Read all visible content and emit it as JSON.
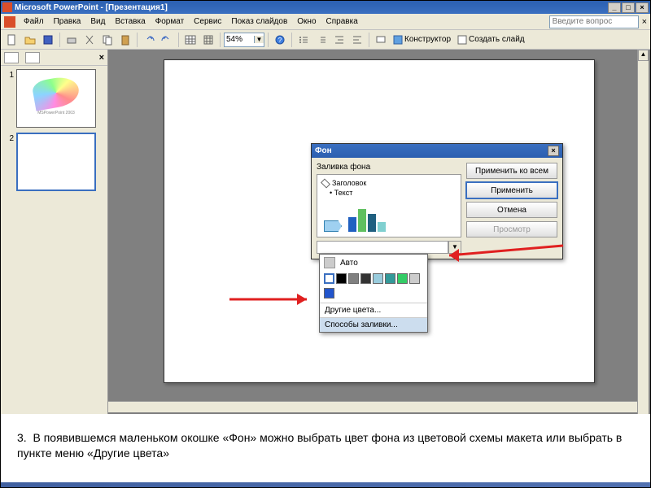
{
  "titlebar": {
    "app": "Microsoft PowerPoint - [Презентация1]"
  },
  "menu": {
    "file": "Файл",
    "edit": "Правка",
    "view": "Вид",
    "insert": "Вставка",
    "format": "Формат",
    "service": "Сервис",
    "slideshow": "Показ слайдов",
    "window": "Окно",
    "help": "Справка",
    "help_placeholder": "Введите вопрос"
  },
  "toolbar": {
    "zoom": "54%",
    "designer": "Конструктор",
    "new_slide": "Создать слайд"
  },
  "thumbs": {
    "n1": "1",
    "n2": "2",
    "slide1_caption": "MSPowerPoint 2003"
  },
  "dialog": {
    "title": "Фон",
    "section": "Заливка фона",
    "preview_title": "Заголовок",
    "preview_text": "Текст",
    "apply_all": "Применить ко всем",
    "apply": "Применить",
    "cancel": "Отмена",
    "preview_btn": "Просмотр"
  },
  "popup": {
    "auto": "Авто",
    "more_colors": "Другие цвета...",
    "fill_methods": "Способы заливки...",
    "swatches_row1": [
      "#ffffff",
      "#000000",
      "#808080",
      "#333333",
      "#99ccdd",
      "#339999",
      "#33cc66",
      "#cccccc"
    ],
    "swatch_row2": "#2255cc"
  },
  "caption": {
    "num": "3.",
    "text": "В появившемся маленьком окошке «Фон» можно выбрать цвет фона из цветовой схемы макета или выбрать в пункте меню «Другие цвета»"
  }
}
